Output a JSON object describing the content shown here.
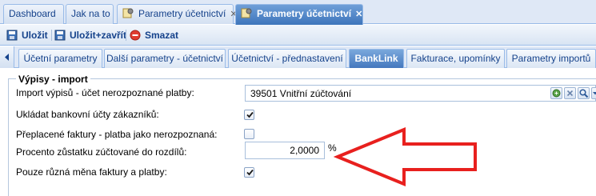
{
  "top_tabs": [
    {
      "label": "Dashboard"
    },
    {
      "label": "Jak na to"
    },
    {
      "label": "Parametry účetnictví"
    },
    {
      "label": "Parametry účetnictví"
    }
  ],
  "toolbar": {
    "save_label": "Uložit",
    "save_close_label": "Uložit+zavřít",
    "delete_label": "Smazat"
  },
  "sub_tabs": [
    {
      "label": "Účetní parametry"
    },
    {
      "label": "Další parametry - účetnictví"
    },
    {
      "label": "Účetnictví - přednastavení"
    },
    {
      "label": "BankLink"
    },
    {
      "label": "Fakturace, upomínky"
    },
    {
      "label": "Parametry importů"
    }
  ],
  "section": {
    "legend": "Výpisy - import",
    "import_label": "Import výpisů - účet nerozpoznané platby:",
    "import_value": "39501 Vnitřní zúčtování",
    "save_accounts_label": "Ukládat bankovní účty zákazníků:",
    "save_accounts_checked": true,
    "overpaid_label": "Přeplacené faktury - platba jako nerozpoznaná:",
    "overpaid_checked": false,
    "percent_label": "Procento zůstatku zúčtované do rozdílů:",
    "percent_value": "2,0000",
    "percent_unit": "%",
    "currency_label": "Pouze různá měna faktury a platby:",
    "currency_checked": true
  },
  "annotation_color": "#e8201e"
}
